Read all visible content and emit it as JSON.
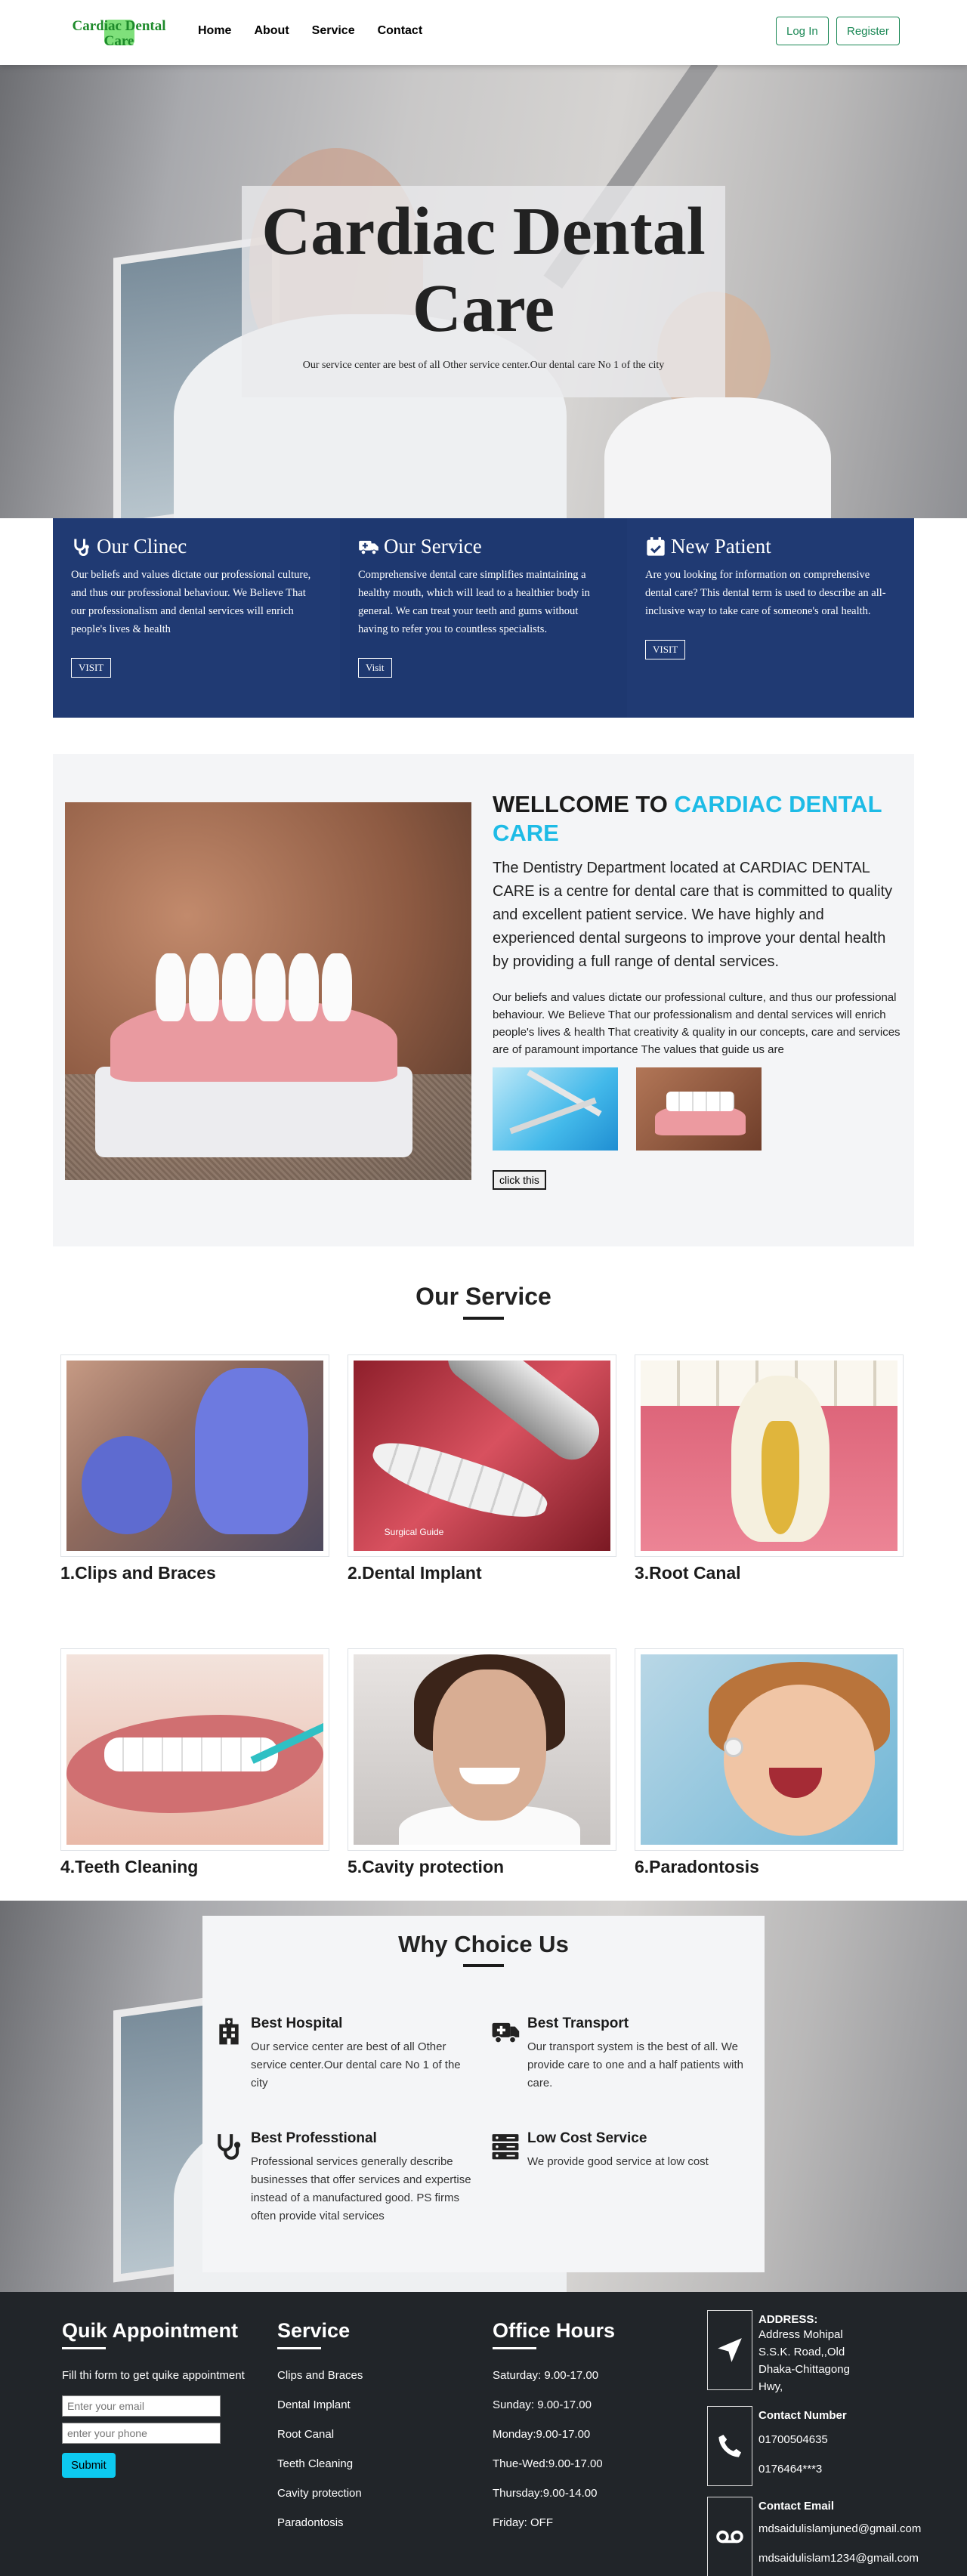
{
  "nav": {
    "logo_line1": "Cardiac Dental",
    "logo_line2": "Care",
    "links": [
      "Home",
      "About",
      "Service",
      "Contact"
    ],
    "login": "Log In",
    "register": "Register"
  },
  "hero": {
    "title_line1": "Cardiac Dental",
    "title_line2": "Care",
    "subtitle": "Our service center are best of all Other service center.Our dental care No 1 of the city"
  },
  "info_cards": [
    {
      "title": "Our Clinec",
      "icon": "stethoscope-icon",
      "text": "Our beliefs and values dictate our professional culture, and thus our professional behaviour. We Believe That our professionalism and dental services will enrich people's lives & health",
      "button": "VISIT"
    },
    {
      "title": "Our Service",
      "icon": "truck-medical-icon",
      "text": "Comprehensive dental care simplifies maintaining a healthy mouth, which will lead to a healthier body in general. We can treat your teeth and gums without having to refer you to countless specialists.",
      "button": "Visit"
    },
    {
      "title": "New Patient",
      "icon": "calendar-check-icon",
      "text": "Are you looking for information on comprehensive dental care? This dental term is used to describe an all-inclusive way to take care of someone's oral health.",
      "button": "VISIT"
    }
  ],
  "welcome": {
    "title_plain": "WELLCOME TO",
    "title_highlight": "CARDIAC DENTAL CARE",
    "lead": "The Dentistry Department located at CARDIAC DENTAL CARE is a centre for dental care that is committed to quality and excellent patient service. We have highly and experienced dental surgeons to improve your dental health by providing a full range of dental services.",
    "para": "Our beliefs and values dictate our professional culture, and thus our professional behaviour. We Believe That our professionalism and dental services will enrich people's lives & health That creativity & quality in our concepts, care and services are of paramount importance The values that guide us are",
    "button": "click this"
  },
  "services": {
    "heading": "Our Service",
    "items": [
      {
        "name": "1.Clips and Braces"
      },
      {
        "name": "2.Dental Implant",
        "caption": "Surgical Guide"
      },
      {
        "name": "3.Root Canal"
      },
      {
        "name": "4.Teeth Cleaning"
      },
      {
        "name": "5.Cavity protection"
      },
      {
        "name": "6.Paradontosis"
      }
    ]
  },
  "why": {
    "heading": "Why Choice Us",
    "items": [
      {
        "title": "Best Hospital",
        "icon": "hospital-icon",
        "text": "Our service center are best of all Other service center.Our dental care No 1 of the city"
      },
      {
        "title": "Best Transport",
        "icon": "ambulance-icon",
        "text": "Our transport system is the best of all. We provide care to one and a half patients with care."
      },
      {
        "title": "Best Professtional",
        "icon": "stethoscope-icon",
        "text": "Professional services generally describe businesses that offer services and expertise instead of a manufactured good. PS firms often provide vital services"
      },
      {
        "title": "Low Cost Service",
        "icon": "server-icon",
        "text": "We provide good service at low cost"
      }
    ]
  },
  "footer": {
    "appointment": {
      "title": "Quik Appointment",
      "text": "Fill thi form to get quike appointment",
      "email_placeholder": "Enter your email",
      "phone_placeholder": "enter your phone",
      "submit": "Submit"
    },
    "service": {
      "title": "Service",
      "items": [
        "Clips and Braces",
        "Dental Implant",
        "Root Canal",
        "Teeth Cleaning",
        "Cavity protection",
        "Paradontosis"
      ]
    },
    "hours": {
      "title": "Office Hours",
      "items": [
        "Saturday: 9.00-17.00",
        "Sunday: 9.00-17.00",
        "Monday:9.00-17.00",
        "Thue-Wed:9.00-17.00",
        "Thursday:9.00-14.00",
        "Friday: OFF"
      ]
    },
    "address": {
      "label": "ADDRESS:",
      "value": "Address Mohipal S.S.K. Road,,Old Dhaka-Chittagong Hwy,"
    },
    "contact": {
      "label": "Contact Number",
      "phone1": "01700504635",
      "phone2": "0176464***3"
    },
    "email": {
      "label": "Contact Email",
      "email1": "mdsaidulislamjuned@gmail.com",
      "email2": "mdsaidulislam1234@gmail.com"
    }
  }
}
